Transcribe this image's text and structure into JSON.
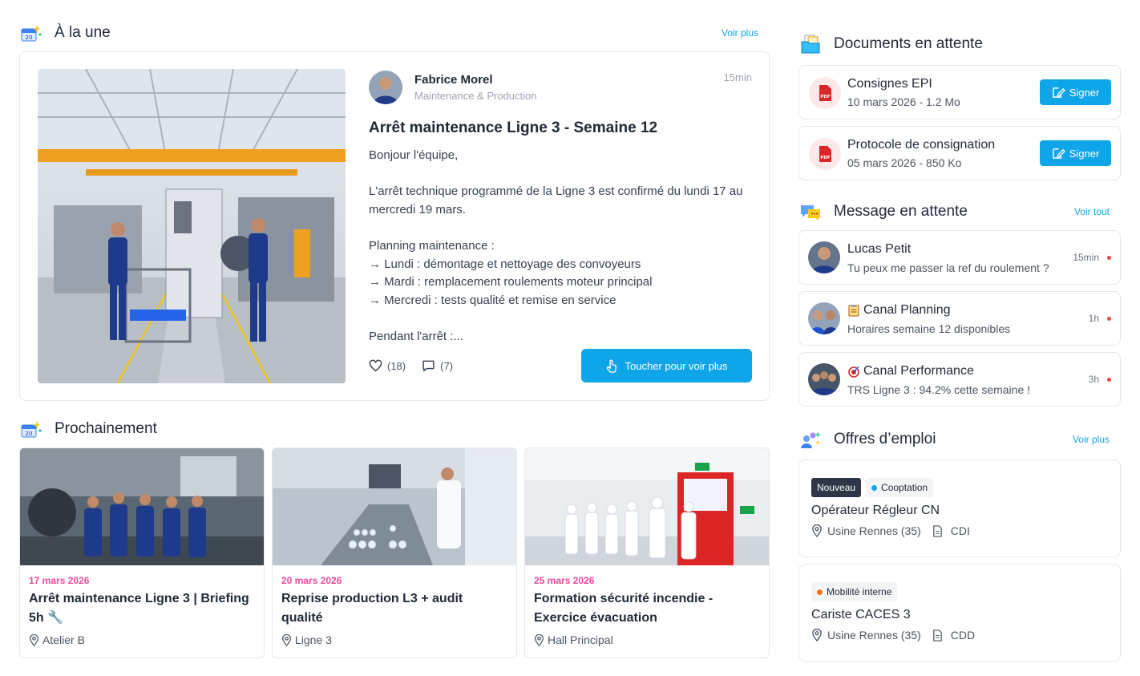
{
  "featured": {
    "section_title": "À la une",
    "see_more": "Voir plus",
    "author_name": "Fabrice Morel",
    "author_dept": "Maintenance & Production",
    "time": "15min",
    "title": "Arrêt maintenance Ligne 3 - Semaine 12",
    "body": "Bonjour l'équipe,\n\nL'arrêt technique programmé de la Ligne 3 est confirmé du lundi 17 au mercredi 19 mars.\n\nPlanning maintenance :\n→ Lundi : démontage et nettoyage des convoyeurs\n→ Mardi : remplacement roulements moteur principal\n→ Mercredi : tests qualité et remise en service\n\nPendant l'arrêt :...",
    "likes": "(18)",
    "comments": "(7)",
    "cta": "Toucher pour voir plus"
  },
  "upcoming": {
    "section_title": "Prochainement",
    "events": [
      {
        "date": "17 mars 2026",
        "title": "Arrêt maintenance Ligne 3 | Briefing 5h 🔧",
        "location": "Atelier B"
      },
      {
        "date": "20 mars 2026",
        "title": "Reprise production L3 + audit qualité",
        "location": "Ligne 3"
      },
      {
        "date": "25 mars 2026",
        "title": "Formation sécurité incendie - Exercice évacuation",
        "location": "Hall Principal"
      }
    ]
  },
  "documents": {
    "section_title": "Documents en attente",
    "sign_label": "Signer",
    "items": [
      {
        "name": "Consignes EPI",
        "meta": "10 mars 2026 - 1.2 Mo"
      },
      {
        "name": "Protocole de consignation",
        "meta": "05 mars 2026 - 850 Ko"
      }
    ]
  },
  "messages": {
    "section_title": "Message en attente",
    "see_all": "Voir tout",
    "items": [
      {
        "name": "Lucas Petit",
        "preview": "Tu peux me passer la ref du roulement ?",
        "time": "15min"
      },
      {
        "name": "Canal Planning",
        "preview": "Horaires semaine 12 disponibles",
        "time": "1h"
      },
      {
        "name": "Canal Performance",
        "preview": "TRS Ligne 3 : 94.2% cette semaine !",
        "time": "3h"
      }
    ]
  },
  "jobs": {
    "section_title": "Offres d’emploi",
    "see_more": "Voir plus",
    "items": [
      {
        "tag_new": "Nouveau",
        "tag": "Cooptation",
        "tag_color": "#0ea5e9",
        "title": "Opérateur Régleur CN",
        "location": "Usine Rennes (35)",
        "contract": "CDI"
      },
      {
        "tag": "Mobilité interne",
        "tag_color": "#f97316",
        "title": "Cariste CACES 3",
        "location": "Usine Rennes (35)",
        "contract": "CDD"
      }
    ]
  },
  "colors": {
    "accent": "#0ea5e9",
    "date_pink": "#ec4899",
    "unread": "#ef4444"
  }
}
